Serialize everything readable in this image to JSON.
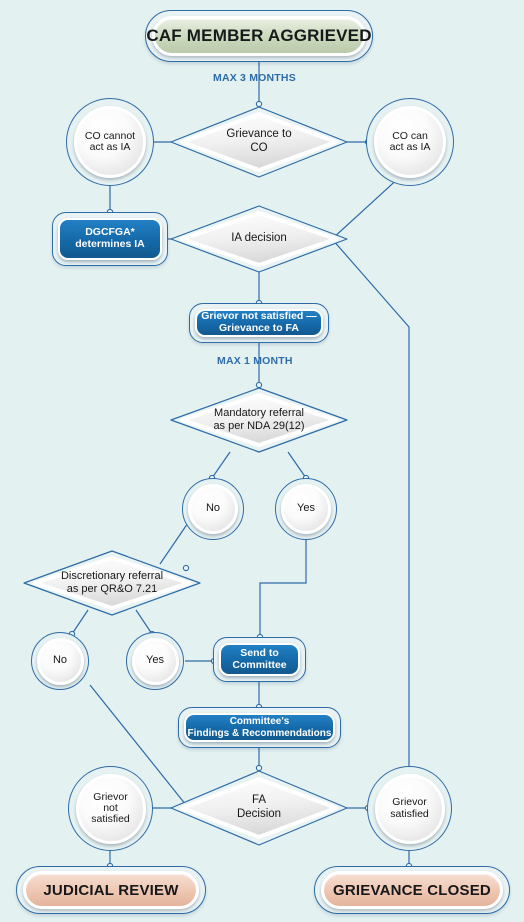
{
  "diagram": {
    "title": "CAF Grievance Process Flowchart",
    "background_color": "#e4f1f1",
    "accent_blue": "#1569a8",
    "line_color": "#2d6ca8",
    "terminal_green": "#cfdcc2",
    "terminal_peach": "#eec6b1"
  },
  "nodes": {
    "start_banner": "CAF MEMBER AGGRIEVED",
    "grievance_to_co": "Grievance to\nCO",
    "co_cannot_act": "CO cannot\nact as IA",
    "co_can_act": "CO can\nact as IA",
    "dgcfga": "DGCFGA*\ndetermines IA",
    "ia_decision": "IA decision",
    "grievor_not_satisfied_fa": "Grievor not satisfied —\nGrievance to FA",
    "mandatory_referral": "Mandatory referral\nas per NDA 29(12)",
    "mandatory_no": "No",
    "mandatory_yes": "Yes",
    "discretionary_referral": "Discretionary referral\nas per QR&O 7.21",
    "discretionary_no": "No",
    "discretionary_yes": "Yes",
    "send_to_committee": "Send to\nCommittee",
    "committee_findings": "Committee's\nFindings & Recommendations",
    "fa_decision": "FA\nDecision",
    "grievor_not_satisfied": "Grievor\nnot\nsatisfied",
    "grievor_satisfied": "Grievor\nsatisfied",
    "judicial_review": "JUDICIAL REVIEW",
    "grievance_closed": "GRIEVANCE CLOSED"
  },
  "edge_labels": {
    "max_3_months": "MAX 3 MONTHS",
    "max_1_month": "MAX 1 MONTH"
  }
}
